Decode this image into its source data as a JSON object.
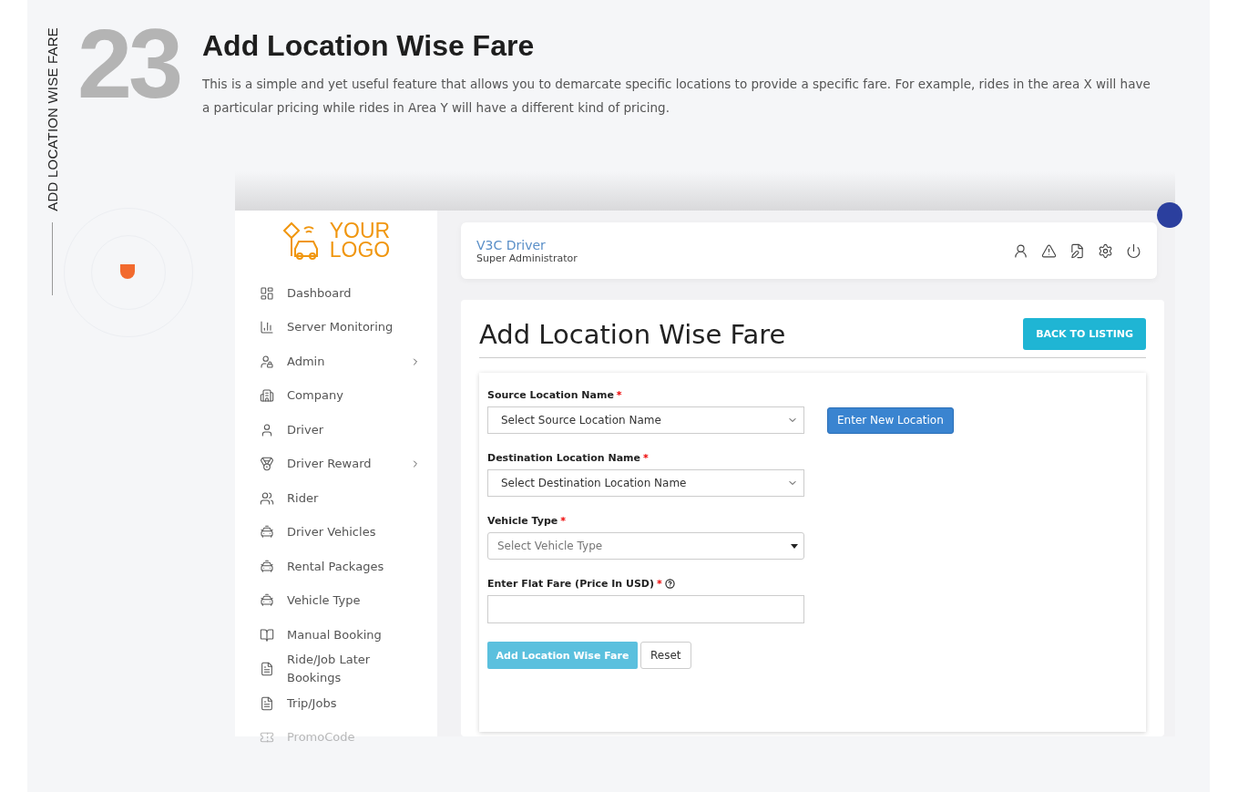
{
  "section": {
    "side_label": "ADD LOCATION WISE FARE",
    "number": "23",
    "title": "Add Location Wise Fare",
    "description": "This is a simple and yet useful feature that allows you to demarcate specific locations to provide a specific fare. For example, rides in the area X will have a particular pricing while rides in Area Y will have a different kind of pricing."
  },
  "app": {
    "logo": {
      "line1": "YOUR",
      "line2": "LOGO"
    },
    "sidebar": {
      "items": [
        {
          "label": "Dashboard",
          "has_submenu": false,
          "faded": false
        },
        {
          "label": "Server Monitoring",
          "has_submenu": false,
          "faded": false
        },
        {
          "label": "Admin",
          "has_submenu": true,
          "faded": false
        },
        {
          "label": "Company",
          "has_submenu": false,
          "faded": false
        },
        {
          "label": "Driver",
          "has_submenu": false,
          "faded": false
        },
        {
          "label": "Driver Reward",
          "has_submenu": true,
          "faded": false
        },
        {
          "label": "Rider",
          "has_submenu": false,
          "faded": false
        },
        {
          "label": "Driver Vehicles",
          "has_submenu": false,
          "faded": false
        },
        {
          "label": "Rental Packages",
          "has_submenu": false,
          "faded": false
        },
        {
          "label": "Vehicle Type",
          "has_submenu": false,
          "faded": false
        },
        {
          "label": "Manual Booking",
          "has_submenu": false,
          "faded": false
        },
        {
          "label": "Ride/Job Later Bookings",
          "has_submenu": false,
          "faded": false
        },
        {
          "label": "Trip/Jobs",
          "has_submenu": false,
          "faded": false
        },
        {
          "label": "PromoCode",
          "has_submenu": false,
          "faded": true
        }
      ]
    },
    "header": {
      "user_name": "V3C Driver",
      "role": "Super Administrator"
    },
    "page_title": "Add Location Wise Fare",
    "back_button": "BACK TO LISTING",
    "form": {
      "required_mark": "*",
      "fields": [
        {
          "kind": "select",
          "label": "Source Location Name",
          "required": true,
          "placeholder": "Select Source Location Name",
          "side_button": "Enter New Location"
        },
        {
          "kind": "select",
          "label": "Destination Location Name",
          "required": true,
          "placeholder": "Select Destination Location Name"
        },
        {
          "kind": "dropdown",
          "label": "Vehicle Type",
          "required": true,
          "placeholder": "Select Vehicle Type"
        },
        {
          "kind": "text",
          "label": "Enter Flat Fare (Price In USD)",
          "required": true,
          "help": true
        }
      ],
      "submit": "Add Location Wise Fare",
      "reset": "Reset"
    }
  }
}
